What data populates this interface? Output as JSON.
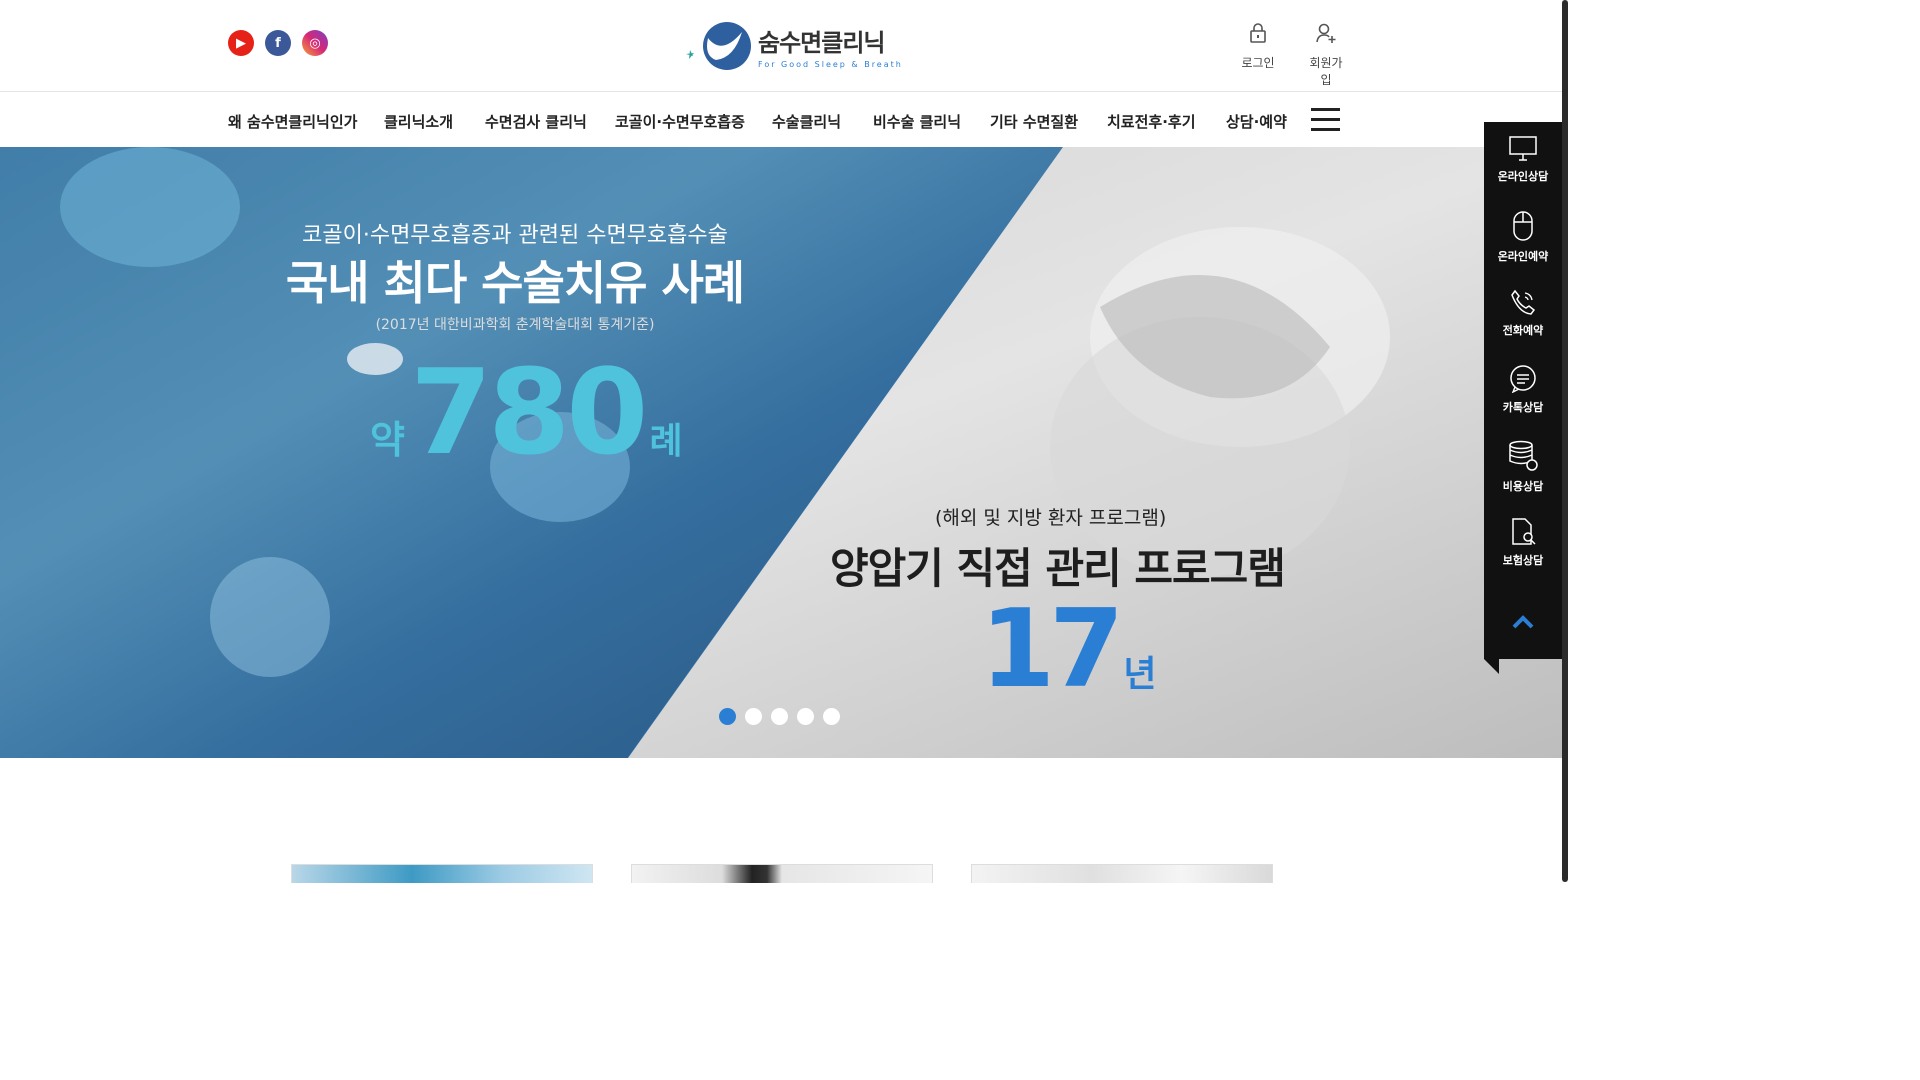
{
  "header": {
    "social": [
      "youtube-icon",
      "facebook-icon",
      "instagram-icon"
    ],
    "logo_title": "숨수면클리닉",
    "logo_sub": "For Good Sleep & Breath",
    "login_label": "로그인",
    "signup_label": "회원가입"
  },
  "nav": {
    "items": [
      "왜 숨수면클리닉인가",
      "클리닉소개",
      "수면검사 클리닉",
      "코골이·수면무호흡증",
      "수술클리닉",
      "비수술 클리닉",
      "기타 수면질환",
      "치료전후·후기",
      "상담·예약"
    ]
  },
  "hero": {
    "left_sub": "코골이·수면무호흡증과 관련된 수면무호흡수술",
    "left_main": "국내 최다 수술치유 사례",
    "left_note": "(2017년 대한비과학회 춘계학술대회 통계기준)",
    "left_pre": "약",
    "left_number": "780",
    "left_suffix": "례",
    "right_sub": "(해외 및 지방 환자 프로그램)",
    "right_main": "양압기 직접 관리 프로그램",
    "right_number": "17",
    "right_suffix": "년",
    "slides_total": 5,
    "active_slide": 1
  },
  "side_menu": {
    "items": [
      "온라인상담",
      "온라인예약",
      "전화예약",
      "카톡상담",
      "비용상담",
      "보험상담"
    ]
  },
  "colors": {
    "accent_blue": "#2a7fd4",
    "accent_cyan": "#4fc3dc",
    "side_bg": "#111111"
  }
}
